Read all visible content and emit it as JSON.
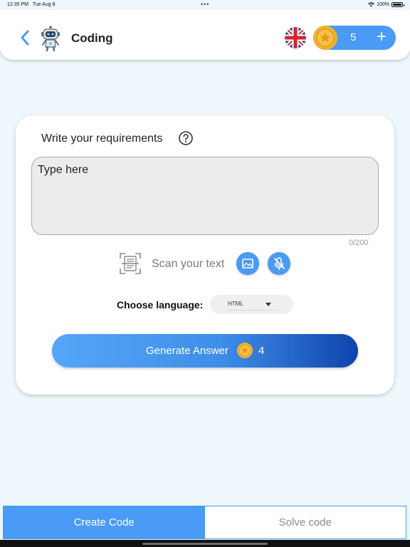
{
  "status_bar": {
    "time": "12:35 PM",
    "date": "Tue Aug 8",
    "battery": "100%"
  },
  "header": {
    "title": "Coins",
    "screen_title": "Coding",
    "coins": "5",
    "add_label": "+"
  },
  "card": {
    "requirements_label": "Write your requirements",
    "input_placeholder": "Type here",
    "char_counter": "0/200",
    "scan_label": "Scan your text",
    "language_label": "Choose language:",
    "language_value": "HTML",
    "generate_label": "Generate Answer",
    "generate_cost": "4"
  },
  "tabs": [
    {
      "label": "Create Code",
      "active": true
    },
    {
      "label": "Solve code",
      "active": false
    }
  ],
  "colors": {
    "accent": "#4a9af6",
    "background": "#eef7fb",
    "coin": "#f2b22e"
  },
  "icons": [
    "back-icon",
    "robot-icon",
    "uk-flag-icon",
    "coin-icon",
    "plus-icon",
    "help-icon",
    "scan-icon",
    "image-icon",
    "mic-off-icon",
    "dropdown-caret-icon"
  ]
}
